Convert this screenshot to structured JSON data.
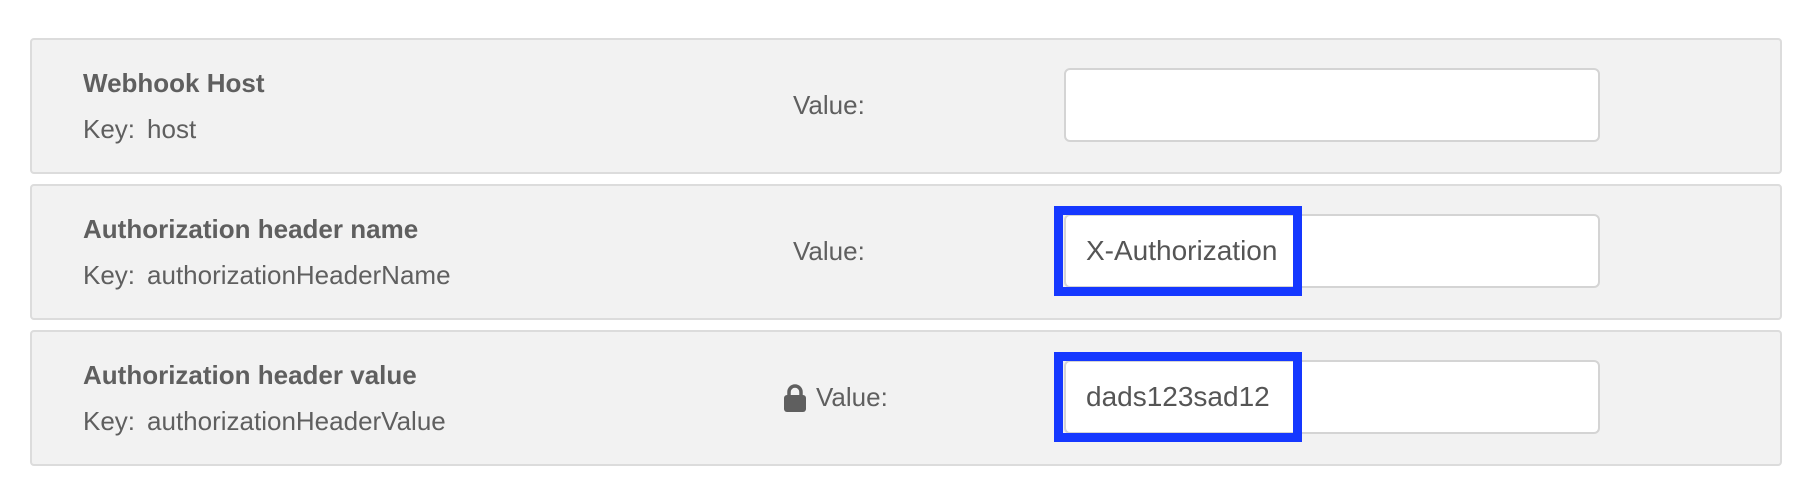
{
  "settings": [
    {
      "title": "Webhook Host",
      "key_prefix": "Key:",
      "key": "host",
      "value_label": "Value:",
      "value": "",
      "secret": false,
      "highlighted": false
    },
    {
      "title": "Authorization header name",
      "key_prefix": "Key:",
      "key": "authorizationHeaderName",
      "value_label": "Value:",
      "value": "X-Authorization",
      "secret": false,
      "highlighted": true
    },
    {
      "title": "Authorization header value",
      "key_prefix": "Key:",
      "key": "authorizationHeaderValue",
      "value_label": "Value:",
      "value": "dads123sad12",
      "secret": true,
      "highlighted": true
    }
  ],
  "icons": {
    "secret_value": "lock-icon"
  },
  "colors": {
    "highlight": "#1538ff",
    "row_background": "#f2f2f2",
    "text": "#5f5f5f"
  }
}
